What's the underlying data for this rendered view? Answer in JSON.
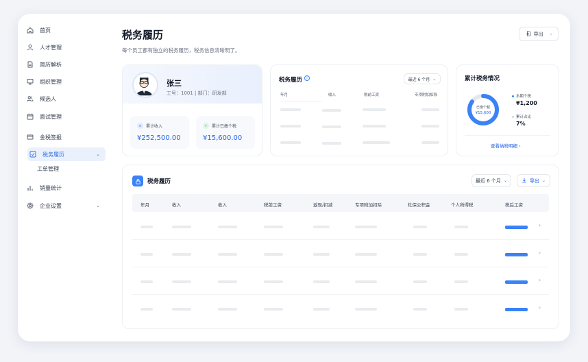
{
  "sidebar": {
    "items": [
      {
        "label": "首页",
        "icon": "home-icon"
      },
      {
        "label": "人才管理",
        "icon": "user-icon"
      },
      {
        "label": "简历解析",
        "icon": "document-icon"
      },
      {
        "label": "组织管理",
        "icon": "monitor-icon"
      },
      {
        "label": "候选人",
        "icon": "users-icon"
      },
      {
        "label": "面试管理",
        "icon": "calendar-icon"
      },
      {
        "label": "金税签报",
        "icon": "card-icon"
      },
      {
        "label": "税务履历",
        "icon": "check-square-icon"
      },
      {
        "label": "工单管理",
        "icon": ""
      },
      {
        "label": "销量统计",
        "icon": "bar-chart-icon"
      },
      {
        "label": "企业设置",
        "icon": "gear-icon"
      }
    ]
  },
  "header": {
    "title": "税务履历",
    "subtitle": "每个员工都有独立的税务履历，税务信息清晰明了。",
    "export_label": "导出"
  },
  "profile": {
    "name": "张三",
    "meta": "工号：1001  |  部门：研发部",
    "income_label": "累计收入",
    "income_value": "¥252,500.00",
    "tax_label": "累计已缴个税",
    "tax_value": "¥15,600.00"
  },
  "history_card": {
    "title": "税务履历",
    "filter": "最近 6 个月",
    "columns": [
      "年月",
      "收入",
      "税前工资",
      "专项附加扣除"
    ]
  },
  "summary_card": {
    "title": "累计税务情况",
    "donut_label": "已缴个税",
    "donut_value": "¥15,600",
    "donut_fraction": 0.85,
    "legend": [
      {
        "label": "本期个税",
        "value": "¥1,200",
        "color": "#3b82f6"
      },
      {
        "label": "累计占比",
        "value": "7%",
        "color": "#d1d5db"
      }
    ],
    "link": "查看纳税明细"
  },
  "table": {
    "title": "税务履历",
    "filter": "最近 6 个月",
    "export_label": "导出",
    "columns": [
      "年月",
      "收入",
      "收入",
      "税前工资",
      "返现/扣减",
      "专项附加扣除",
      "社保公积金",
      "个人所得税",
      "税后工资"
    ]
  },
  "colors": {
    "accent": "#2563eb",
    "active_bg": "#eaf1fd"
  }
}
